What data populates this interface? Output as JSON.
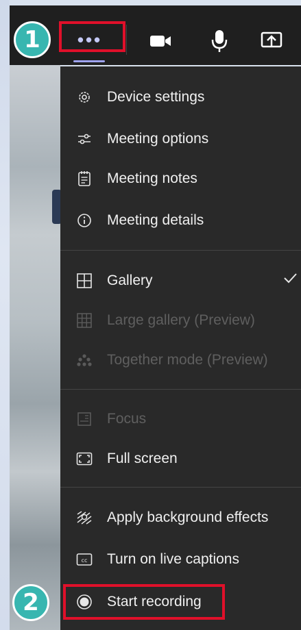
{
  "toolbar": {
    "more_icon": "more-dots-icon",
    "camera_icon": "video-camera-icon",
    "mic_icon": "microphone-icon",
    "share_icon": "share-screen-icon"
  },
  "badges": {
    "step1": "1",
    "step2": "2"
  },
  "menu": {
    "device_settings": "Device settings",
    "meeting_options": "Meeting options",
    "meeting_notes": "Meeting notes",
    "meeting_details": "Meeting details",
    "gallery": "Gallery",
    "large_gallery": "Large gallery (Preview)",
    "together_mode": "Together mode (Preview)",
    "focus": "Focus",
    "full_screen": "Full screen",
    "background_effects": "Apply background effects",
    "live_captions": "Turn on live captions",
    "start_recording": "Start recording",
    "gallery_selected": true
  },
  "colors": {
    "menu_bg": "#292929",
    "toolbar_bg": "#1f1f1f",
    "accent": "#9ea2ee",
    "highlight": "#e0102a",
    "badge": "#38b6b0"
  }
}
